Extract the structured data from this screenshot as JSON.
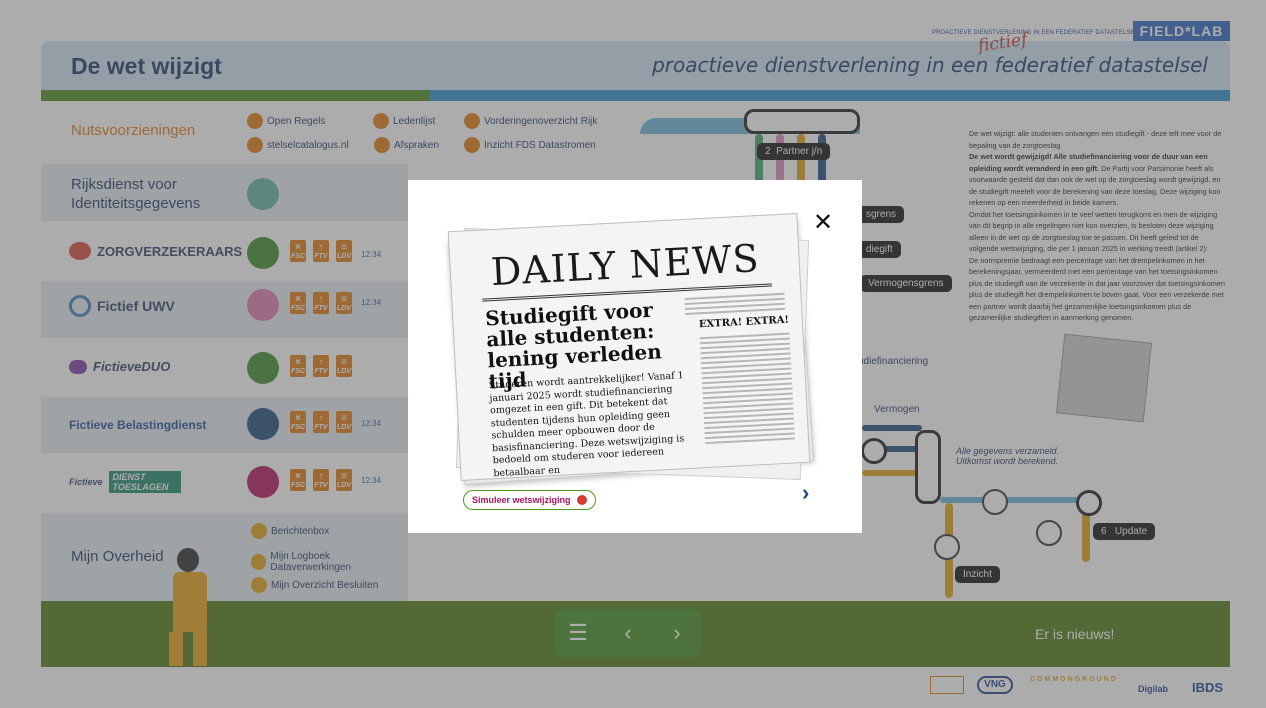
{
  "header": {
    "fds_small": "PROACTIEVE DIENSTVERLENING IN EEN FEDERATIEF DATASTELSEL",
    "fieldlab": "FIELD*LAB",
    "title": "De wet wijzigt",
    "subtitle": "proactieve dienstverlening in een federatief datastelsel",
    "fictief": "fictief"
  },
  "rows": {
    "nuts_label": "Nutsvoorzieningen",
    "nuts_links": [
      "Open Regels",
      "stelselcatalogus.nl",
      "Ledenlijst",
      "Afspraken",
      "Vorderingenoverzicht Rijk",
      "Inzicht FDS Datastromen"
    ],
    "rvig": "Rijksdienst voor Identiteitsgegevens",
    "zorg": "ZORGVERZEKERAARS",
    "uwv": "Fictief UWV",
    "duo": "FictieveDUO",
    "belast": "Fictieve Belastingdienst",
    "toeslagen_pre": "Fictieve",
    "toeslagen": "DIENST TOESLAGEN",
    "mijn": "Mijn Overheid",
    "mijn_links": [
      "Berichtenbox",
      "Mijn Logboek Dataverwerkingen",
      "Mijn Overzicht Besluiten"
    ],
    "time": "12:34",
    "icon_labels": [
      "FSC",
      "FTV",
      "LDV"
    ]
  },
  "right": {
    "p1": "De wet wijzigt: alle studenten ontvangen een studiegift - deze telt mee voor de bepaling van de zorgtoeslag",
    "p2_bold": "De wet wordt gewijzigd! Alle studiefinanciering voor de duur van een opleiding wordt veranderd in een gift.",
    "p2": "De Partij voor Parsimonie heeft als voorwaarde gesteld dat dan ook de wet op de zorgtoeslag wordt gewijzigd, en de studiegift meetelt voor de berekening van deze toeslag. Deze wijziging kon rekenen op een meerderheid in beide kamers.",
    "p3": "Omdat het toetsingsinkomen in te veel wetten terugkomt en men de wijziging van dit begrip in alle regelingen niet kon overzien, is besloten deze wijziging alleen in de wet op de zorgtoeslag toe te passen. Dit heeft geleid tot de volgende wetswijziging, die per 1 januari 2025 in werking treedt (artikel 2):",
    "p4": "De normpremie bedraagt een percentage van het drempelinkomen in het berekeningsjaar, vermeerderd met een percentage van het toetsingsinkomen plus de studiegift van de verzekerde in dat jaar voorzover dat toetsingsinkomen plus de studiegift het drempelinkomen te boven gaat. Voor een verzekerde met een partner wordt daarbij het gezamenlijke toetsingsinkomen plus de gezamenlijke studiegiften in aanmerking genomen."
  },
  "metro": {
    "pills": [
      "Partner j/n",
      "sgrens",
      "diegift",
      "Vermogensgrens",
      "Update",
      "Inzicht"
    ],
    "num2": "2",
    "num6": "6",
    "vermogen": "Vermogen",
    "studiefin": "udiefinanciering",
    "note": "Alle gegevens verzameld. Uitkomst wordt berekend."
  },
  "footer": {
    "news": "Er is nieuws!",
    "partners": [
      "VNG",
      "COMMONGROUND",
      "Digilab",
      "IBDS"
    ]
  },
  "modal": {
    "masthead": "DAILY NEWS",
    "headline": "Studiegift voor alle studenten: lening verleden tijd",
    "lead": "Studeren wordt aantrekkelijker! Vanaf 1 januari 2025 wordt studiefinanciering omgezet in een gift. Dit betekent dat studenten tijdens hun opleiding geen schulden meer opbouwen door de basisfinanciering. Deze wetswijziging is bedoeld om studeren voor iedereen betaalbaar en",
    "extra": "EXTRA! EXTRA!",
    "sim_button": "Simuleer wetswijziging"
  },
  "colors": {
    "green": "#4f7a13",
    "blue": "#2c8fd0",
    "navy": "#1c3664",
    "orange": "#e07b12"
  }
}
